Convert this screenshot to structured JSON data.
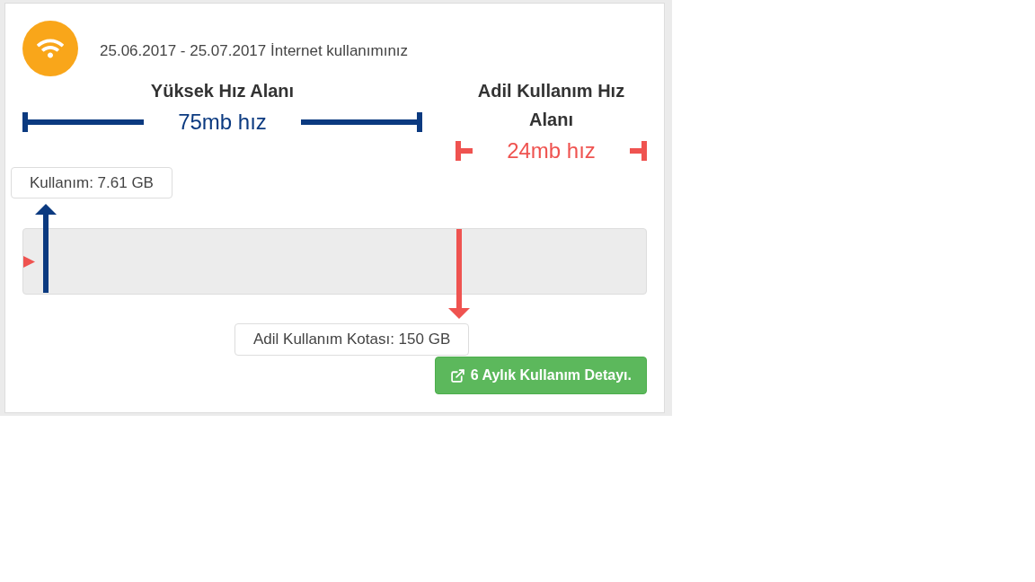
{
  "header": {
    "period": "25.06.2017 - 25.07.2017 İnternet kullanımınız"
  },
  "speed_zones": [
    {
      "title": "Yüksek Hız Alanı",
      "speed": "75mb hız",
      "color": "#0b3a80"
    },
    {
      "title": "Adil Kullanım Hız Alanı",
      "speed": "24mb hız",
      "color": "#ef5350"
    }
  ],
  "usage": {
    "label": "Kullanım: 7.61 GB",
    "level": 0.036
  },
  "quota": {
    "label": "Adil Kullanım Kotası: 150 GB",
    "level": 0.7
  },
  "detail_button": {
    "label": "6 Aylık Kullanım Detayı."
  }
}
